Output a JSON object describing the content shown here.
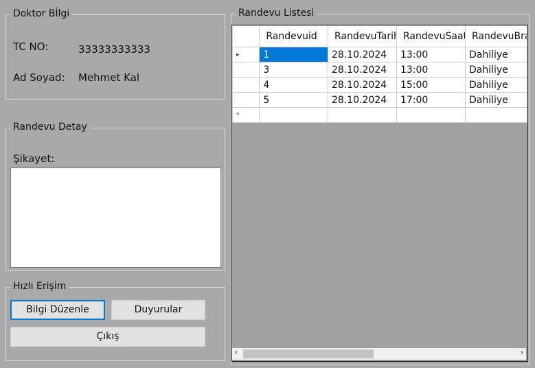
{
  "doctor_info": {
    "title": "Doktor Bİlgi",
    "tc_label": "TC NO:",
    "tc_value": "33333333333",
    "name_label": "Ad Soyad:",
    "name_value": "Mehmet Kal"
  },
  "appointment_detail": {
    "title": "Randevu Detay",
    "complaint_label": "Şikayet:",
    "complaint_value": ""
  },
  "quick_access": {
    "title": "Hızlı Erişim",
    "edit_info": "Bilgi Düzenle",
    "announcements": "Duyurular",
    "exit": "Çıkış"
  },
  "appointment_list": {
    "title": "Randevu Listesi",
    "columns": [
      "Randevuid",
      "RandevuTarih",
      "RandevuSaat",
      "RandevuBrans"
    ],
    "rows": [
      [
        "1",
        "28.10.2024",
        "13:00",
        "Dahiliye"
      ],
      [
        "3",
        "28.10.2024",
        "13:00",
        "Dahiliye"
      ],
      [
        "4",
        "28.10.2024",
        "15:00",
        "Dahiliye"
      ],
      [
        "5",
        "28.10.2024",
        "17:00",
        "Dahiliye"
      ]
    ],
    "selected_row": 0,
    "current_row_marker": "▸",
    "new_row_marker": "*"
  }
}
